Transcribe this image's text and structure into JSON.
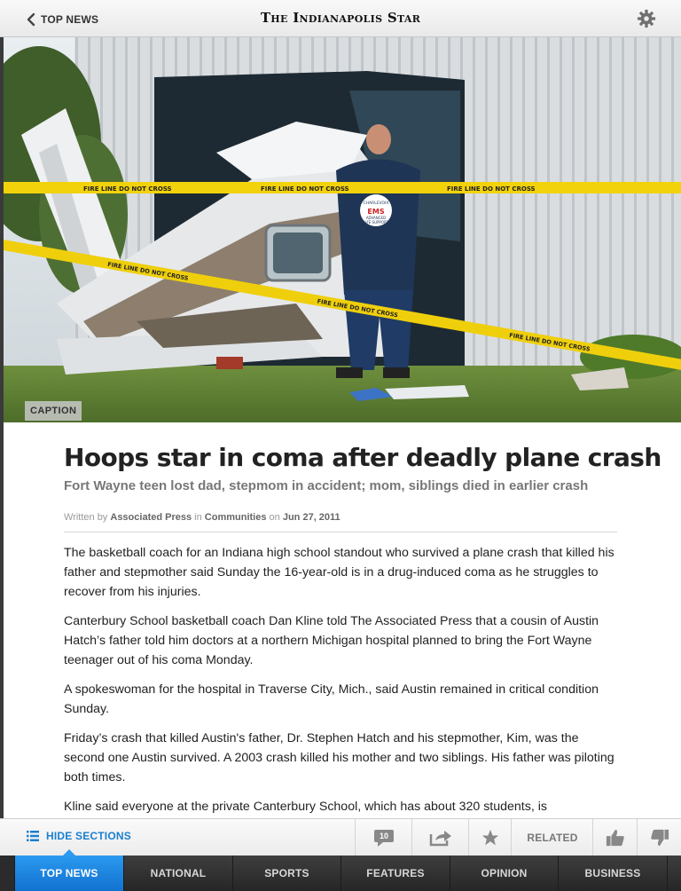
{
  "header": {
    "back_label": "TOP NEWS",
    "masthead": "The Indianapolis Star",
    "settings_icon": "gear-icon"
  },
  "hero": {
    "caption_label": "CAPTION",
    "tape_text": "FIRE LINE DO NOT CROSS",
    "vest_top": "CHARLEVOIX",
    "vest_mid": "EMS",
    "vest_bottom1": "ADVANCED",
    "vest_bottom2": "LIFE SUPPORT"
  },
  "article": {
    "headline": "Hoops star in coma after deadly plane crash",
    "subhead": "Fort Wayne teen lost dad, stepmom in accident; mom, siblings died in earlier crash",
    "byline": {
      "written_by": "Written by",
      "author": "Associated Press",
      "in": "in",
      "section": "Communities",
      "on": "on",
      "date": "Jun 27, 2011"
    },
    "paragraphs": [
      "The basketball coach for an Indiana high school standout who survived a plane crash that killed his father and stepmother said Sunday the 16-year-old is in a drug-induced coma as he struggles to recover from his injuries.",
      "Canterbury School basketball coach Dan Kline told The Associated Press that a cousin of Austin Hatch’s father told him doctors at a northern Michigan hospital planned to bring the Fort Wayne teenager out of his coma Monday.",
      "A spokeswoman for the hospital in Traverse City, Mich., said Austin remained in critical condition Sunday.",
      "Friday’s crash that killed Austin's father, Dr. Stephen Hatch and his stepmother, Kim, was the second one Austin survived. A 2003 crash killed his mother and two siblings. His father was piloting both times.",
      "Kline said everyone at the private Canterbury School, which has about 320 students, is"
    ]
  },
  "actionbar": {
    "hide_sections_label": "HIDE SECTIONS",
    "comment_count": "10",
    "related_label": "RELATED"
  },
  "tabs": [
    {
      "label": "TOP NEWS",
      "active": true
    },
    {
      "label": "NATIONAL",
      "active": false
    },
    {
      "label": "SPORTS",
      "active": false
    },
    {
      "label": "FEATURES",
      "active": false
    },
    {
      "label": "OPINION",
      "active": false
    },
    {
      "label": "BUSINESS",
      "active": false
    }
  ],
  "colors": {
    "accent_blue": "#1a7fd0",
    "tab_active": "#1172cf",
    "tab_bar": "#2b2b2b",
    "caution_tape": "#f2d20a"
  }
}
